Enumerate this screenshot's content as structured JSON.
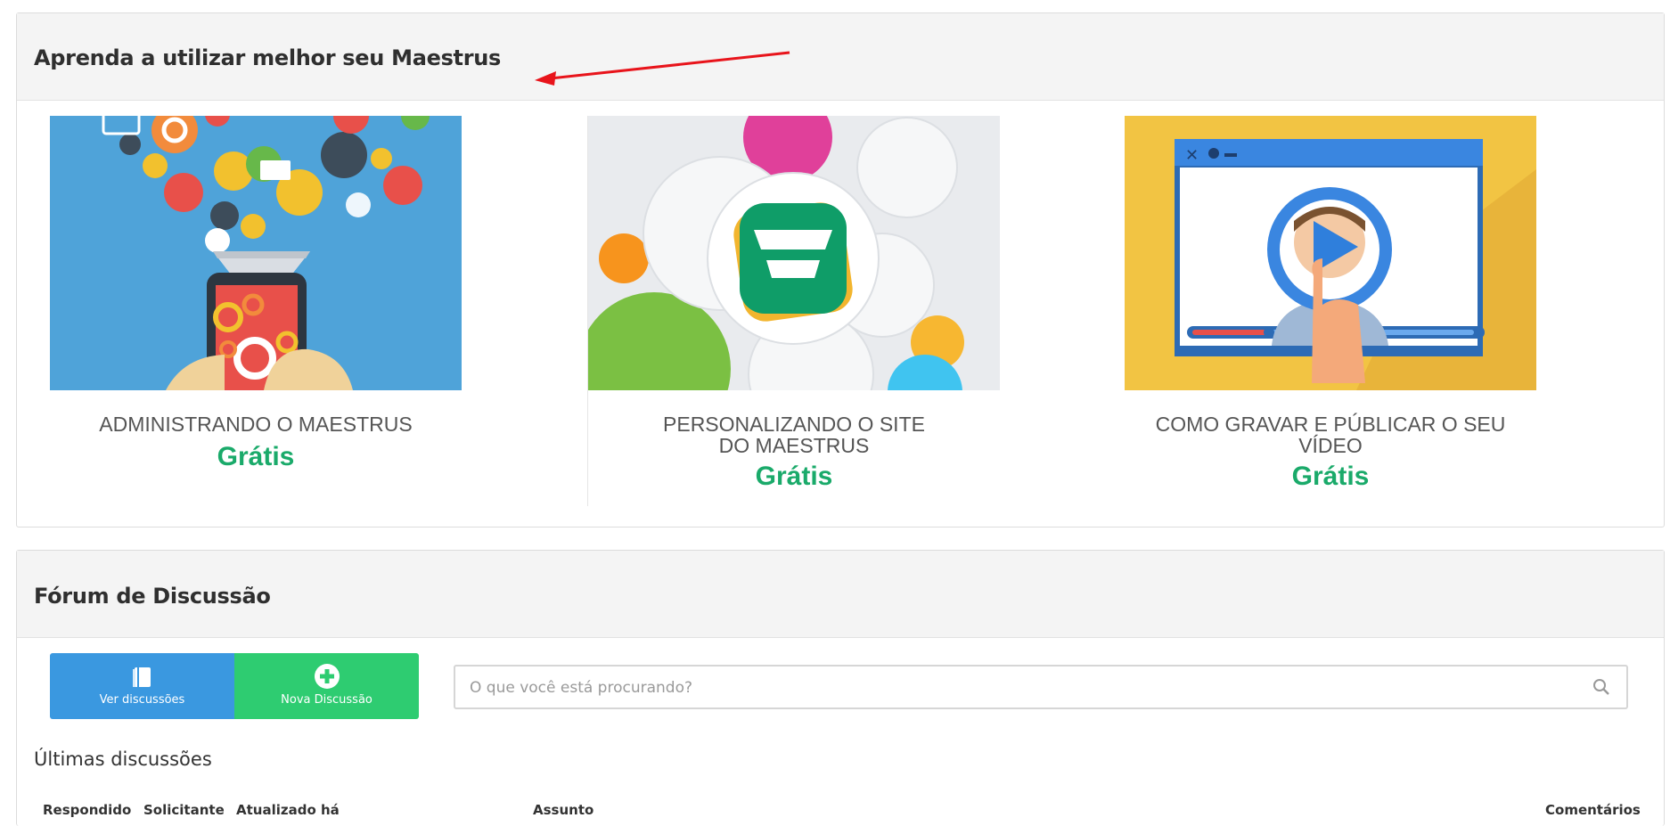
{
  "learn_section": {
    "title": "Aprenda a utilizar melhor seu Maestrus",
    "courses": [
      {
        "name": "ADMINISTRANDO O MAESTRUS",
        "price": "Grátis"
      },
      {
        "name": "PERSONALIZANDO O SITE DO MAESTRUS",
        "price": "Grátis"
      },
      {
        "name": "COMO GRAVAR E PÚBLICAR O SEU VÍDEO",
        "price": "Grátis"
      }
    ]
  },
  "forum_section": {
    "title": "Fórum de Discussão",
    "view_button": {
      "label": "Ver discussões",
      "icon": "book-icon"
    },
    "new_button": {
      "label": "Nova Discussão",
      "icon": "plus-circle-icon"
    },
    "search": {
      "placeholder": "O que você está procurando?",
      "value": "",
      "icon": "search-icon"
    },
    "latest_title": "Últimas discussões",
    "columns": [
      "Respondido",
      "Solicitante",
      "Atualizado há",
      "Assunto",
      "Comentários"
    ]
  },
  "colors": {
    "accent_blue": "#3a98e0",
    "accent_green": "#2ecc71",
    "price_green": "#1aaa6a",
    "annotation_red": "#e8141b"
  }
}
